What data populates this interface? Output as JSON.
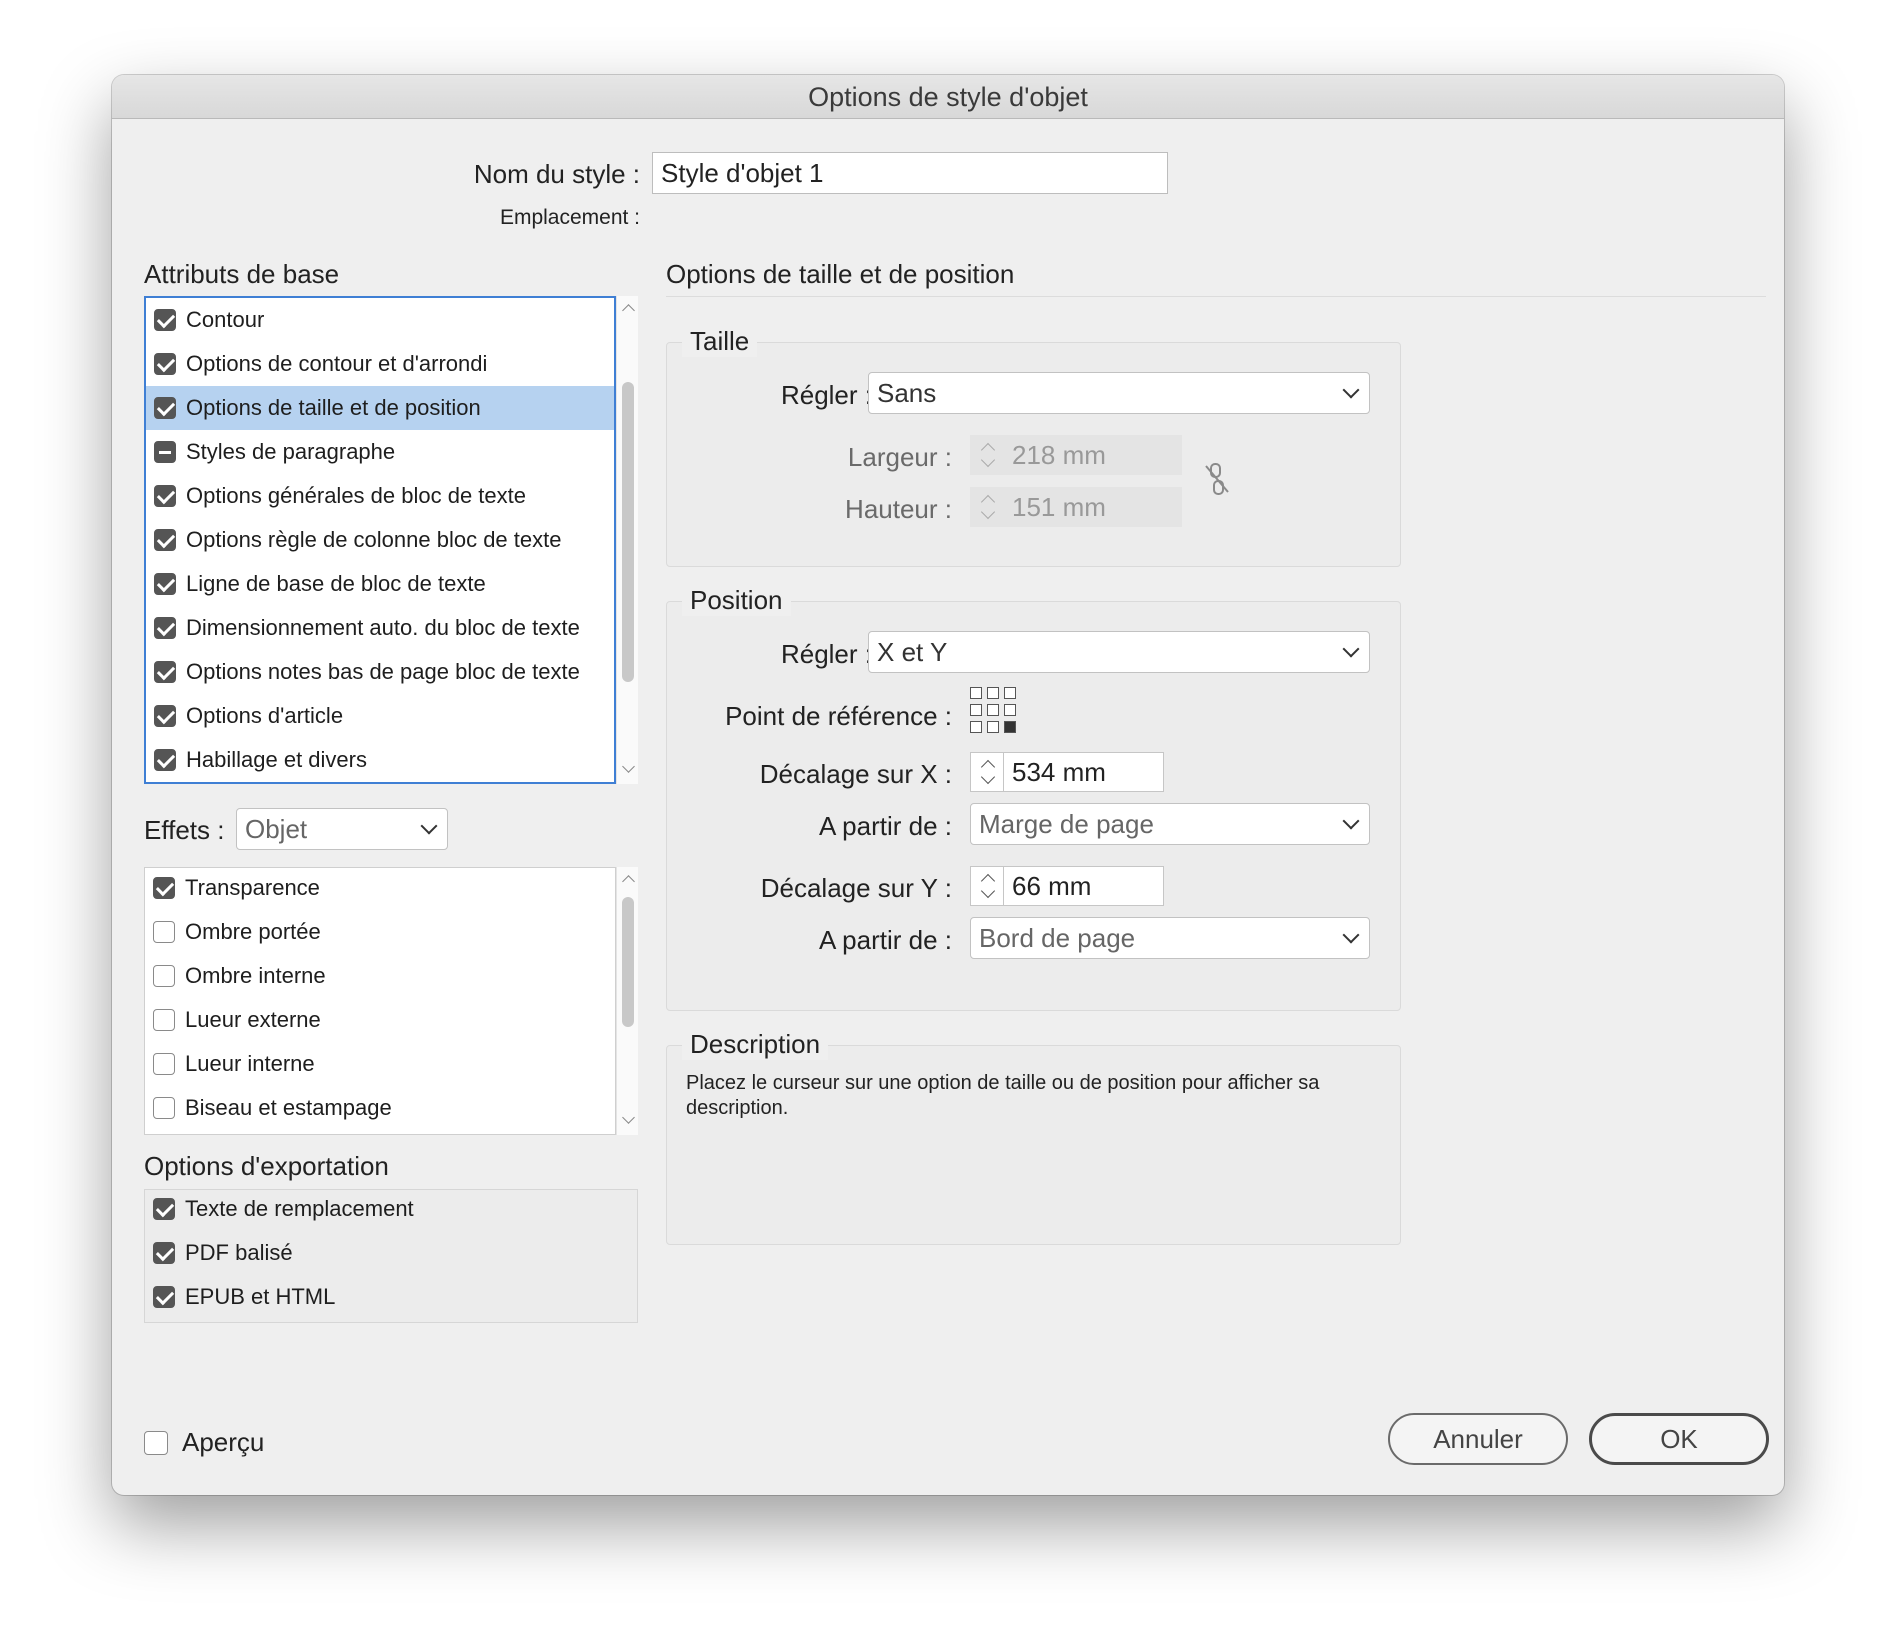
{
  "dialog": {
    "title": "Options de style d'objet"
  },
  "style_name": {
    "label": "Nom du style :",
    "value": "Style d'objet 1"
  },
  "location": {
    "label": "Emplacement :"
  },
  "basic_attributes": {
    "heading": "Attributs de base",
    "items": [
      {
        "label": "Contour",
        "state": "checked"
      },
      {
        "label": "Options de contour et d'arrondi",
        "state": "checked"
      },
      {
        "label": "Options de taille et de position",
        "state": "checked",
        "selected": true
      },
      {
        "label": "Styles de paragraphe",
        "state": "mixed"
      },
      {
        "label": "Options générales de bloc de texte",
        "state": "checked"
      },
      {
        "label": "Options règle de colonne bloc de texte",
        "state": "checked"
      },
      {
        "label": "Ligne de base de bloc de texte",
        "state": "checked"
      },
      {
        "label": "Dimensionnement auto. du bloc de texte",
        "state": "checked"
      },
      {
        "label": "Options notes bas de page bloc de texte",
        "state": "checked"
      },
      {
        "label": "Options d'article",
        "state": "checked"
      },
      {
        "label": "Habillage et divers",
        "state": "checked"
      }
    ]
  },
  "effects": {
    "label": "Effets :",
    "selected": "Objet",
    "items": [
      {
        "label": "Transparence",
        "state": "checked"
      },
      {
        "label": "Ombre portée",
        "state": "unchecked"
      },
      {
        "label": "Ombre interne",
        "state": "unchecked"
      },
      {
        "label": "Lueur externe",
        "state": "unchecked"
      },
      {
        "label": "Lueur interne",
        "state": "unchecked"
      },
      {
        "label": "Biseau et estampage",
        "state": "unchecked"
      }
    ]
  },
  "export_options": {
    "heading": "Options d'exportation",
    "items": [
      {
        "label": "Texte de remplacement",
        "state": "checked"
      },
      {
        "label": "PDF balisé",
        "state": "checked"
      },
      {
        "label": "EPUB et HTML",
        "state": "checked"
      }
    ]
  },
  "panel": {
    "heading": "Options de taille et de position",
    "size": {
      "title": "Taille",
      "adjust_label": "Régler :",
      "adjust_value": "Sans",
      "width_label": "Largeur :",
      "width_value": "218 mm",
      "height_label": "Hauteur :",
      "height_value": "151 mm",
      "link_icon": "chain-broken-icon"
    },
    "position": {
      "title": "Position",
      "adjust_label": "Régler :",
      "adjust_value": "X et Y",
      "ref_point_label": "Point de référence :",
      "x_offset_label": "Décalage sur X :",
      "x_offset_value": "534 mm",
      "x_from_label": "A partir de :",
      "x_from_value": "Marge de page",
      "y_offset_label": "Décalage sur Y :",
      "y_offset_value": "66 mm",
      "y_from_label": "A partir de :",
      "y_from_value": "Bord de page"
    },
    "description": {
      "title": "Description",
      "text": "Placez le curseur sur une option de taille ou de position pour afficher sa description."
    }
  },
  "preview": {
    "label": "Aperçu",
    "state": "unchecked"
  },
  "buttons": {
    "cancel": "Annuler",
    "ok": "OK"
  },
  "colors": {
    "selection": "#b6d2f0",
    "focus_ring": "#3f7fd4",
    "dialog_bg": "#efefef"
  }
}
